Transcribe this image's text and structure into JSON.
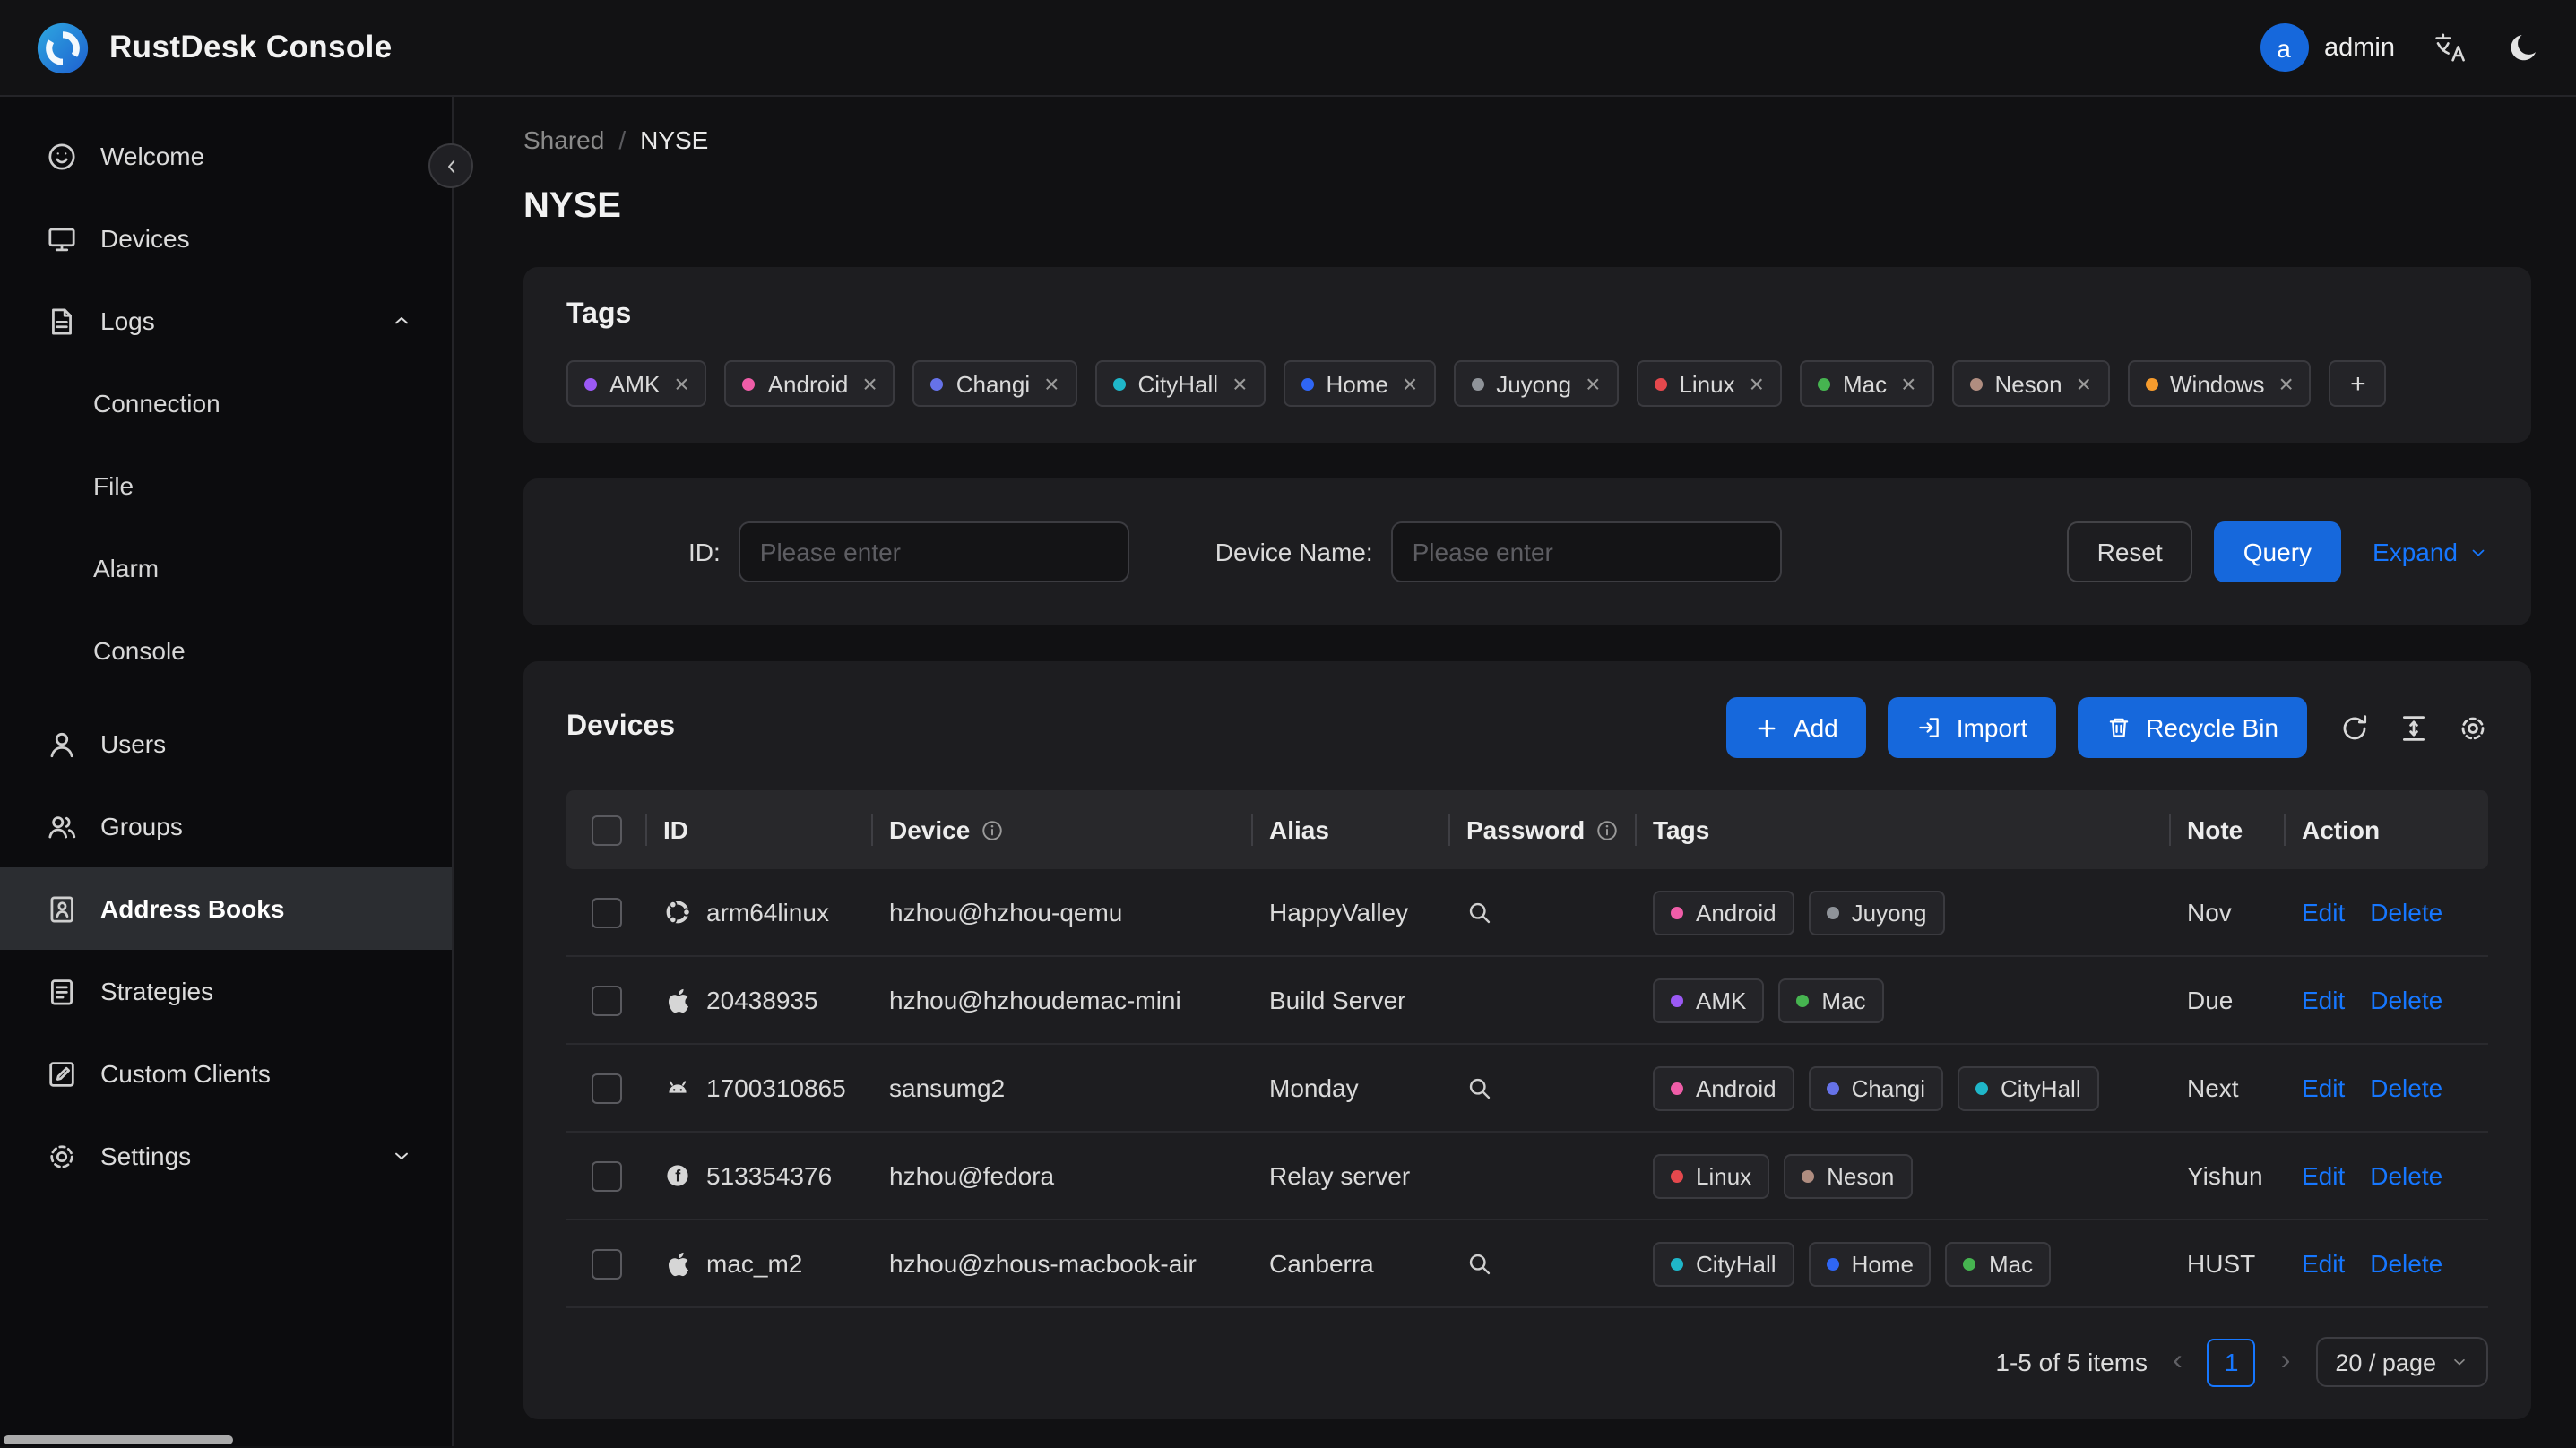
{
  "header": {
    "app_title": "RustDesk Console",
    "user_initial": "a",
    "user_name": "admin"
  },
  "sidebar": {
    "welcome": "Welcome",
    "devices": "Devices",
    "logs": "Logs",
    "logs_children": {
      "connection": "Connection",
      "file": "File",
      "alarm": "Alarm",
      "console": "Console"
    },
    "users": "Users",
    "groups": "Groups",
    "address_books": "Address Books",
    "strategies": "Strategies",
    "custom_clients": "Custom Clients",
    "settings": "Settings"
  },
  "breadcrumb": {
    "parent": "Shared",
    "separator": "/",
    "current": "NYSE"
  },
  "page_title": "NYSE",
  "tags_card": {
    "title": "Tags",
    "tags": [
      "AMK",
      "Android",
      "Changi",
      "CityHall",
      "Home",
      "Juyong",
      "Linux",
      "Mac",
      "Neson",
      "Windows"
    ],
    "add_button": "+"
  },
  "tag_colors": {
    "AMK": "#9b59f5",
    "Android": "#ef5da8",
    "Changi": "#6672e8",
    "CityHall": "#1fb6c9",
    "Home": "#2f66f4",
    "Juyong": "#8f9399",
    "Linux": "#e5484d",
    "Mac": "#46b450",
    "Neson": "#b08d80",
    "Windows": "#f59b2d"
  },
  "filter": {
    "id_label": "ID:",
    "device_label": "Device Name:",
    "placeholder": "Please enter",
    "reset": "Reset",
    "query": "Query",
    "expand": "Expand"
  },
  "devices": {
    "title": "Devices",
    "add": "Add",
    "import": "Import",
    "recycle_bin": "Recycle Bin",
    "table": {
      "headers": {
        "id": "ID",
        "device": "Device",
        "alias": "Alias",
        "password": "Password",
        "tags": "Tags",
        "note": "Note",
        "action": "Action"
      },
      "edit": "Edit",
      "delete": "Delete",
      "rows": [
        {
          "os": "ubuntu",
          "id": "arm64linux",
          "device": "hzhou@hzhou-qemu",
          "alias": "HappyValley",
          "has_password": true,
          "tags": [
            "Android",
            "Juyong"
          ],
          "note": "Nov"
        },
        {
          "os": "apple",
          "id": "20438935",
          "device": "hzhou@hzhoudemac-mini",
          "alias": "Build Server",
          "has_password": false,
          "tags": [
            "AMK",
            "Mac"
          ],
          "note": "Due"
        },
        {
          "os": "android",
          "id": "1700310865",
          "device": "sansumg2",
          "alias": "Monday",
          "has_password": true,
          "tags": [
            "Android",
            "Changi",
            "CityHall"
          ],
          "note": "Next"
        },
        {
          "os": "fedora",
          "id": "513354376",
          "device": "hzhou@fedora",
          "alias": "Relay server",
          "has_password": false,
          "tags": [
            "Linux",
            "Neson"
          ],
          "note": "Yishun"
        },
        {
          "os": "apple",
          "id": "mac_m2",
          "device": "hzhou@zhous-macbook-air",
          "alias": "Canberra",
          "has_password": true,
          "tags": [
            "CityHall",
            "Home",
            "Mac"
          ],
          "note": "HUST"
        }
      ]
    },
    "pagination": {
      "summary": "1-5 of 5 items",
      "prev": "‹",
      "page": "1",
      "next": "›",
      "page_size": "20 / page"
    }
  },
  "colors": {
    "accent": "#1677ff",
    "primary_button": "#1668dc",
    "card_bg": "#1d1d20",
    "page_bg": "#111113",
    "sidebar_bg": "#0c0c0e",
    "table_header_bg": "#28282b"
  }
}
